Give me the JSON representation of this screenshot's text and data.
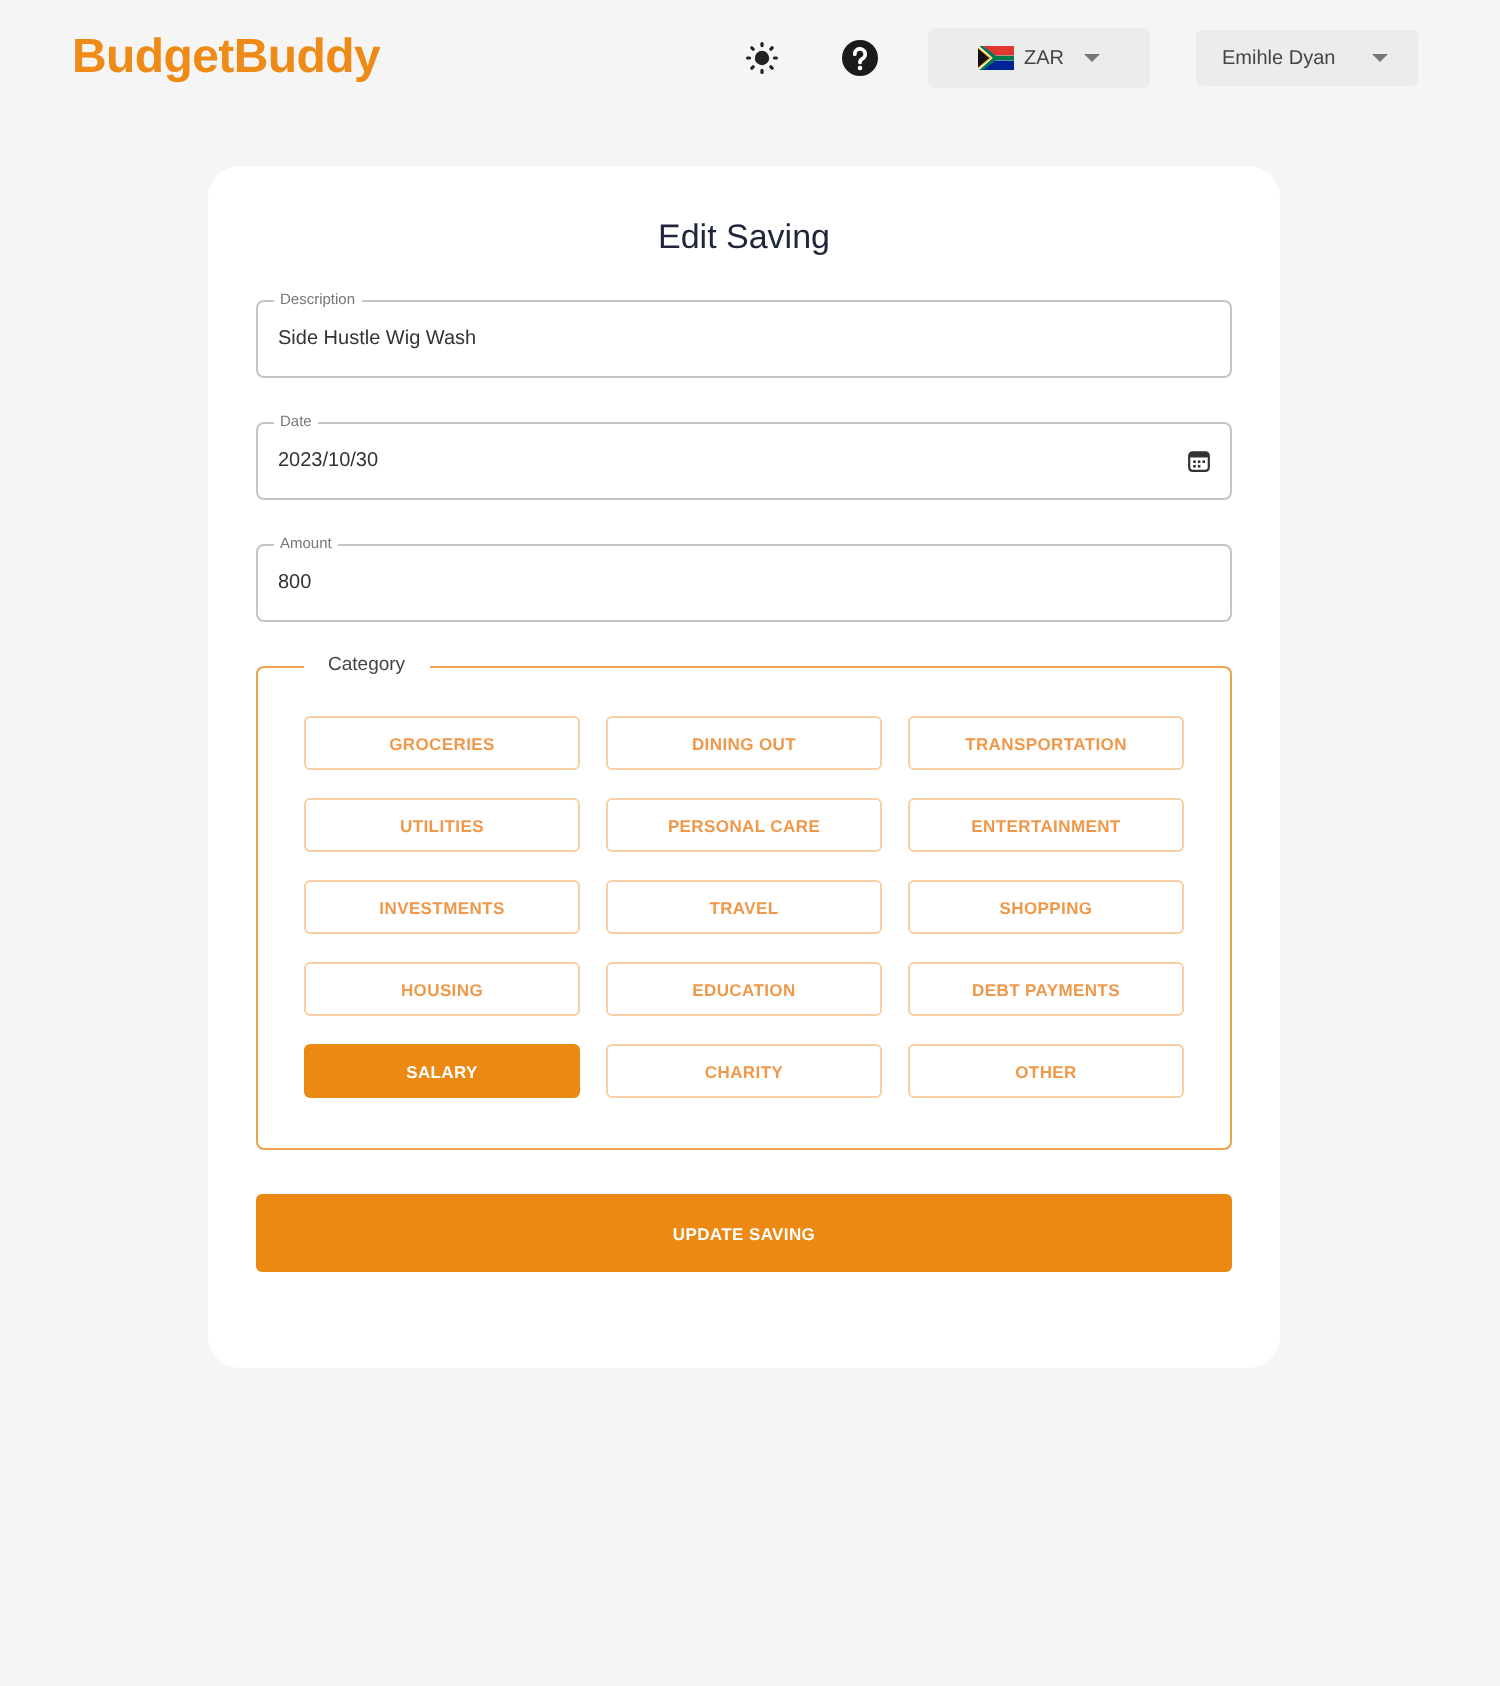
{
  "header": {
    "logo": "BudgetBuddy",
    "currency": {
      "code": "ZAR"
    },
    "user": {
      "name": "Emihle Dyan"
    }
  },
  "form": {
    "title": "Edit Saving",
    "fields": [
      {
        "kind": "text",
        "label": "Description",
        "value": "Side Hustle Wig Wash"
      },
      {
        "kind": "date",
        "label": "Date",
        "value": "2023/10/30"
      },
      {
        "kind": "number",
        "label": "Amount",
        "value": "800"
      }
    ],
    "category": {
      "legend": "Category",
      "options": [
        {
          "label": "GROCERIES",
          "selected": false
        },
        {
          "label": "DINING OUT",
          "selected": false
        },
        {
          "label": "TRANSPORTATION",
          "selected": false
        },
        {
          "label": "UTILITIES",
          "selected": false
        },
        {
          "label": "PERSONAL CARE",
          "selected": false
        },
        {
          "label": "ENTERTAINMENT",
          "selected": false
        },
        {
          "label": "INVESTMENTS",
          "selected": false
        },
        {
          "label": "TRAVEL",
          "selected": false
        },
        {
          "label": "SHOPPING",
          "selected": false
        },
        {
          "label": "HOUSING",
          "selected": false
        },
        {
          "label": "EDUCATION",
          "selected": false
        },
        {
          "label": "DEBT PAYMENTS",
          "selected": false
        },
        {
          "label": "SALARY",
          "selected": true
        },
        {
          "label": "CHARITY",
          "selected": false
        },
        {
          "label": "OTHER",
          "selected": false
        }
      ]
    },
    "submit": {
      "label": "UPDATE SAVING"
    }
  }
}
